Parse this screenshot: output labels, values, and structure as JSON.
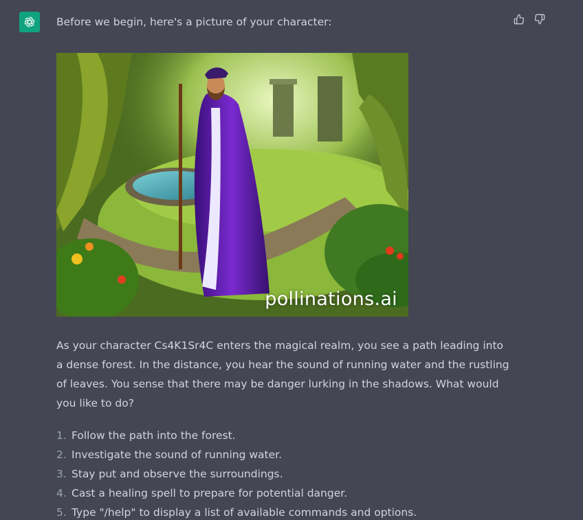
{
  "message": {
    "intro": "Before we begin, here's a picture of your character:",
    "image": {
      "alt": "Wizard character in purple robe standing in an enchanted forest",
      "watermark": "pollinations.ai"
    },
    "story": "As your character Cs4K1Sr4C enters the magical realm, you see a path leading into a dense forest. In the distance, you hear the sound of running water and the rustling of leaves. You sense that there may be danger lurking in the shadows. What would you like to do?",
    "options": [
      {
        "num": "1.",
        "text": "Follow the path into the forest."
      },
      {
        "num": "2.",
        "text": "Investigate the sound of running water."
      },
      {
        "num": "3.",
        "text": "Stay put and observe the surroundings."
      },
      {
        "num": "4.",
        "text": "Cast a healing spell to prepare for potential danger."
      },
      {
        "num": "5.",
        "text": "Type \"/help\" to display a list of available commands and options."
      }
    ]
  },
  "icons": {
    "avatar": "openai-logo-icon",
    "thumbs_up": "thumbs-up-icon",
    "thumbs_down": "thumbs-down-icon"
  },
  "colors": {
    "background": "#444654",
    "avatar": "#10a37f",
    "text": "#d1d5db",
    "muted": "#9ca3af"
  }
}
